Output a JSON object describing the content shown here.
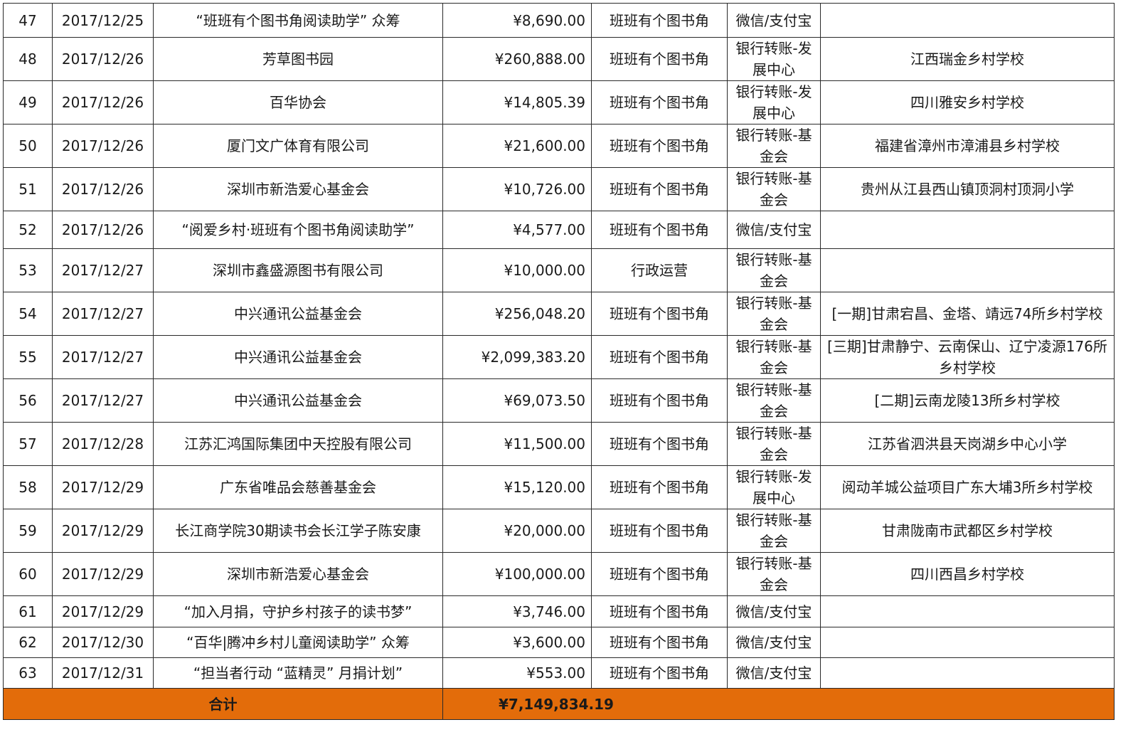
{
  "rows": [
    {
      "no": "47",
      "date": "2017/12/25",
      "donor": "“班班有个图书角阅读助学” 众筹",
      "amount": "¥8,690.00",
      "project": "班班有个图书角",
      "method": "微信/支付宝",
      "beneficiary": ""
    },
    {
      "no": "48",
      "date": "2017/12/26",
      "donor": "芳草图书园",
      "amount": "¥260,888.00",
      "project": "班班有个图书角",
      "method": "银行转账-发展中心",
      "beneficiary": "江西瑞金乡村学校"
    },
    {
      "no": "49",
      "date": "2017/12/26",
      "donor": "百华协会",
      "amount": "¥14,805.39",
      "project": "班班有个图书角",
      "method": "银行转账-发展中心",
      "beneficiary": "四川雅安乡村学校"
    },
    {
      "no": "50",
      "date": "2017/12/26",
      "donor": "厦门文广体育有限公司",
      "amount": "¥21,600.00",
      "project": "班班有个图书角",
      "method": "银行转账-基金会",
      "beneficiary": "福建省漳州市漳浦县乡村学校"
    },
    {
      "no": "51",
      "date": "2017/12/26",
      "donor": "深圳市新浩爱心基金会",
      "amount": "¥10,726.00",
      "project": "班班有个图书角",
      "method": "银行转账-基金会",
      "beneficiary": "贵州从江县西山镇顶洞村顶洞小学"
    },
    {
      "no": "52",
      "date": "2017/12/26",
      "donor": "“阅爱乡村·班班有个图书角阅读助学”",
      "amount": "¥4,577.00",
      "project": "班班有个图书角",
      "method": "微信/支付宝",
      "beneficiary": ""
    },
    {
      "no": "53",
      "date": "2017/12/27",
      "donor": "深圳市鑫盛源图书有限公司",
      "amount": "¥10,000.00",
      "project": "行政运营",
      "method": "银行转账-基金会",
      "beneficiary": ""
    },
    {
      "no": "54",
      "date": "2017/12/27",
      "donor": "中兴通讯公益基金会",
      "amount": "¥256,048.20",
      "project": "班班有个图书角",
      "method": "银行转账-基金会",
      "beneficiary": "[一期]甘肃宕昌、金塔、靖远74所乡村学校"
    },
    {
      "no": "55",
      "date": "2017/12/27",
      "donor": "中兴通讯公益基金会",
      "amount": "¥2,099,383.20",
      "project": "班班有个图书角",
      "method": "银行转账-基金会",
      "beneficiary": "[三期]甘肃静宁、云南保山、辽宁凌源176所乡村学校"
    },
    {
      "no": "56",
      "date": "2017/12/27",
      "donor": "中兴通讯公益基金会",
      "amount": "¥69,073.50",
      "project": "班班有个图书角",
      "method": "银行转账-基金会",
      "beneficiary": "[二期]云南龙陵13所乡村学校"
    },
    {
      "no": "57",
      "date": "2017/12/28",
      "donor": "江苏汇鸿国际集团中天控股有限公司",
      "amount": "¥11,500.00",
      "project": "班班有个图书角",
      "method": "银行转账-基金会",
      "beneficiary": "江苏省泗洪县天岗湖乡中心小学"
    },
    {
      "no": "58",
      "date": "2017/12/29",
      "donor": "广东省唯品会慈善基金会",
      "amount": "¥15,120.00",
      "project": "班班有个图书角",
      "method": "银行转账-发展中心",
      "beneficiary": "阅动羊城公益项目广东大埔3所乡村学校"
    },
    {
      "no": "59",
      "date": "2017/12/29",
      "donor": "长江商学院30期读书会长江学子陈安康",
      "amount": "¥20,000.00",
      "project": "班班有个图书角",
      "method": "银行转账-基金会",
      "beneficiary": "甘肃陇南市武都区乡村学校"
    },
    {
      "no": "60",
      "date": "2017/12/29",
      "donor": "深圳市新浩爱心基金会",
      "amount": "¥100,000.00",
      "project": "班班有个图书角",
      "method": "银行转账-基金会",
      "beneficiary": "四川西昌乡村学校"
    },
    {
      "no": "61",
      "date": "2017/12/29",
      "donor": "“加入月捐，守护乡村孩子的读书梦”",
      "amount": "¥3,746.00",
      "project": "班班有个图书角",
      "method": "微信/支付宝",
      "beneficiary": ""
    },
    {
      "no": "62",
      "date": "2017/12/30",
      "donor": "“百华|腾冲乡村儿童阅读助学” 众筹",
      "amount": "¥3,600.00",
      "project": "班班有个图书角",
      "method": "微信/支付宝",
      "beneficiary": ""
    },
    {
      "no": "63",
      "date": "2017/12/31",
      "donor": "“担当者行动 “蓝精灵” 月捐计划”",
      "amount": "¥553.00",
      "project": "班班有个图书角",
      "method": "微信/支付宝",
      "beneficiary": ""
    }
  ],
  "total": {
    "label": "合计",
    "amount": "¥7,149,834.19"
  }
}
